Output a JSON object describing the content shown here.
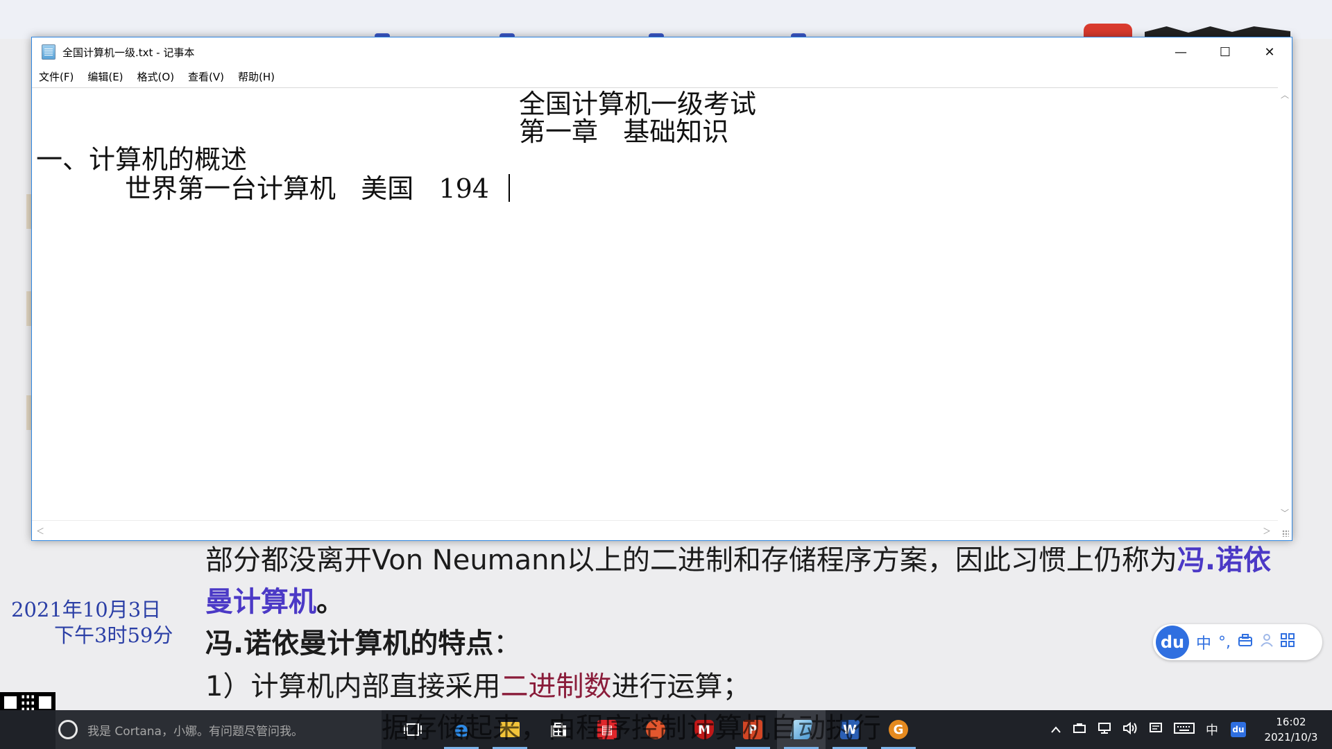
{
  "window": {
    "title": "全国计算机一级.txt - 记事本",
    "minimize_glyph": "—",
    "maximize_glyph": "☐",
    "close_glyph": "✕",
    "icon": "notepad-icon"
  },
  "menu": {
    "file": "文件(F)",
    "edit": "编辑(E)",
    "format": "格式(O)",
    "view": "查看(V)",
    "help": "帮助(H)"
  },
  "document": {
    "line1": "全国计算机一级考试",
    "line2": "第一章   基础知识",
    "line3": "一、计算机的概述",
    "line4": "世界第一台计算机   美国   194"
  },
  "scroll": {
    "up": "︿",
    "down": "﹀",
    "left": "＜",
    "right": "＞"
  },
  "slide": {
    "line1_a": "部分都没离开Von Neumann以上的二进制和存储程序方案，因此习惯上仍称为",
    "line1_b": "冯.诺依",
    "line2_a": "曼计算机",
    "line2_b": "。",
    "line3_a": "冯.诺依曼计算机的特点",
    "line3_b": "：",
    "line4_a": "1）计算机内部直接采用",
    "line4_b": "二进制数",
    "line4_c": "进行运算；",
    "date_line1": "2021年10月3日",
    "date_line2": "下午3时59分",
    "subtitle_partial": "据存储起来，由程序控制计算机自动执行"
  },
  "ime": {
    "logo": "du",
    "mode": "中",
    "punct": "°,",
    "toolbox_icon": "toolbox-icon",
    "user_icon": "user-icon",
    "grid_icon": "grid-icon"
  },
  "taskbar": {
    "search_placeholder": "我是 Cortana，小娜。有问题尽管问我。",
    "icons": [
      "task-view-icon",
      "edge-icon",
      "file-explorer-icon",
      "store-icon",
      "reader-icon",
      "paint-icon",
      "mcafee-icon",
      "powerpoint-icon",
      "notepad-icon",
      "word-icon",
      "app-icon"
    ],
    "tray_lang": "中",
    "tray_du": "du",
    "time": "16:02",
    "date": "2021/10/3"
  },
  "colors": {
    "accent_blue": "#2f86e1",
    "highlight_blue": "#4b39c6",
    "highlight_red": "#8a1c3a",
    "date_blue": "#2b3fa6",
    "taskbar_bg": "#1f2228"
  }
}
